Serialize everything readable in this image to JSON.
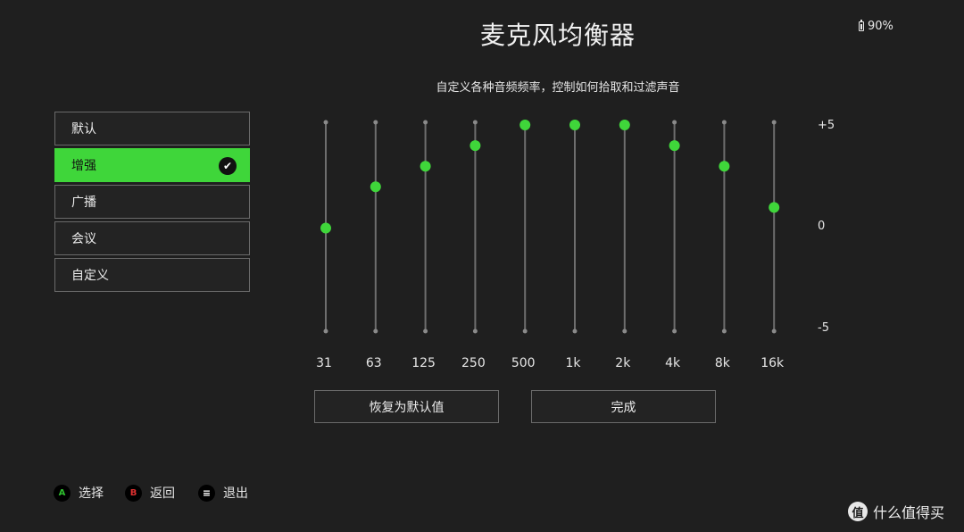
{
  "header": {
    "title": "麦克风均衡器",
    "subtitle": "自定义各种音频频率，控制如何拾取和过滤声音"
  },
  "status": {
    "battery": "90%"
  },
  "presets": [
    {
      "label": "默认",
      "selected": false
    },
    {
      "label": "增强",
      "selected": true
    },
    {
      "label": "广播",
      "selected": false
    },
    {
      "label": "会议",
      "selected": false
    },
    {
      "label": "自定义",
      "selected": false
    }
  ],
  "equalizer": {
    "bands": [
      "31",
      "63",
      "125",
      "250",
      "500",
      "1k",
      "2k",
      "4k",
      "8k",
      "16k"
    ],
    "values": [
      0,
      2,
      3,
      4,
      5,
      5,
      5,
      4,
      3,
      1
    ],
    "scale_labels": {
      "max": "+5",
      "mid": "0",
      "min": "-5"
    },
    "range": [
      -5,
      5
    ]
  },
  "actions": {
    "reset_label": "恢复为默认值",
    "done_label": "完成"
  },
  "footer": {
    "hints": [
      {
        "key": "A",
        "label": "选择"
      },
      {
        "key": "B",
        "label": "返回"
      },
      {
        "key": "≡",
        "label": "退出"
      }
    ],
    "watermark": "什么值得买"
  },
  "colors": {
    "accent": "#3fd63a",
    "background": "#1f1f1f"
  }
}
